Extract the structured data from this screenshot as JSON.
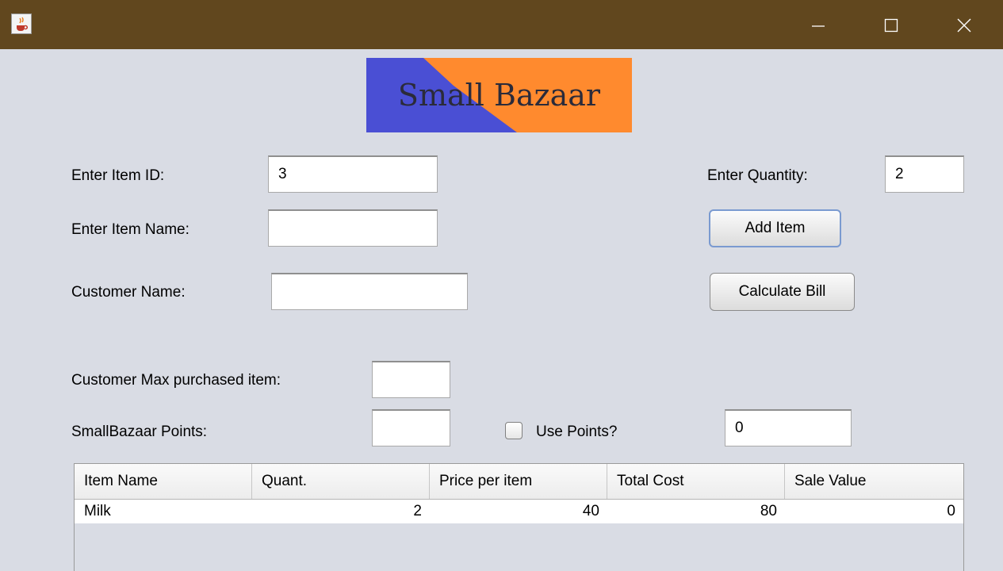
{
  "window": {
    "icon": "java-cup-icon"
  },
  "logo": {
    "text": "Small Bazaar",
    "colors": [
      "#4a4fd4",
      "#ff8a2e"
    ]
  },
  "form": {
    "item_id_label": "Enter Item ID:",
    "item_id_value": "3",
    "item_name_label": "Enter Item Name:",
    "item_name_value": "",
    "customer_name_label": "Customer Name:",
    "customer_name_value": "",
    "quantity_label": "Enter Quantity:",
    "quantity_value": "2",
    "max_item_label": "Customer Max purchased item:",
    "max_item_value": "",
    "points_label": "SmallBazaar Points:",
    "points_value": "",
    "use_points_label": "Use Points?",
    "use_points_checked": false,
    "points_used_value": "0"
  },
  "buttons": {
    "add_item": "Add Item",
    "calculate_bill": "Calculate Bill"
  },
  "table": {
    "columns": [
      "Item Name",
      "Quant.",
      "Price per item",
      "Total Cost",
      "Sale Value"
    ],
    "rows": [
      {
        "item_name": "Milk",
        "quantity": "2",
        "price": "40",
        "total": "80",
        "sale": "0"
      }
    ]
  },
  "colors": {
    "titlebar": "#61471e",
    "background": "#d9dce4",
    "focus_border": "#7a9ad0"
  }
}
